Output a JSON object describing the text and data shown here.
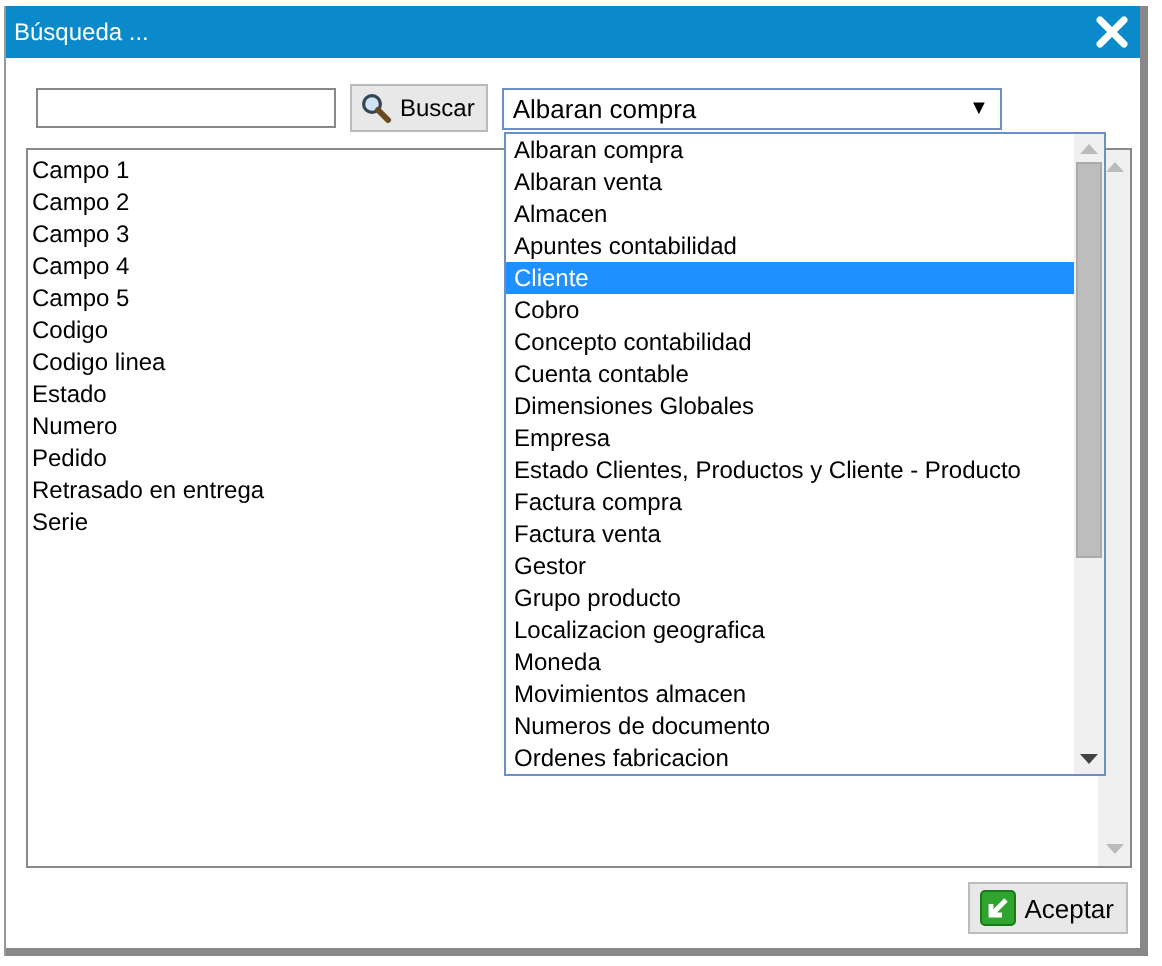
{
  "window": {
    "title": "Búsqueda ..."
  },
  "search": {
    "button": "Buscar"
  },
  "select": {
    "value": "Albaran compra",
    "arrow": "▼",
    "options": [
      {
        "label": "Albaran compra",
        "highlighted": false
      },
      {
        "label": "Albaran venta",
        "highlighted": false
      },
      {
        "label": "Almacen",
        "highlighted": false
      },
      {
        "label": "Apuntes contabilidad",
        "highlighted": false
      },
      {
        "label": "Cliente",
        "highlighted": true
      },
      {
        "label": "Cobro",
        "highlighted": false
      },
      {
        "label": "Concepto contabilidad",
        "highlighted": false
      },
      {
        "label": "Cuenta contable",
        "highlighted": false
      },
      {
        "label": "Dimensiones Globales",
        "highlighted": false
      },
      {
        "label": "Empresa",
        "highlighted": false
      },
      {
        "label": "Estado Clientes, Productos y Cliente - Producto",
        "highlighted": false
      },
      {
        "label": "Factura compra",
        "highlighted": false
      },
      {
        "label": "Factura venta",
        "highlighted": false
      },
      {
        "label": "Gestor",
        "highlighted": false
      },
      {
        "label": "Grupo producto",
        "highlighted": false
      },
      {
        "label": "Localizacion geografica",
        "highlighted": false
      },
      {
        "label": "Moneda",
        "highlighted": false
      },
      {
        "label": "Movimientos almacen",
        "highlighted": false
      },
      {
        "label": "Numeros de documento",
        "highlighted": false
      },
      {
        "label": "Ordenes fabricacion",
        "highlighted": false
      }
    ]
  },
  "fields": [
    "Campo 1",
    "Campo 2",
    "Campo 3",
    "Campo 4",
    "Campo 5",
    "Codigo",
    "Codigo linea",
    "Estado",
    "Numero",
    "Pedido",
    "Retrasado en entrega",
    "Serie"
  ],
  "buttons": {
    "accept": "Aceptar"
  }
}
